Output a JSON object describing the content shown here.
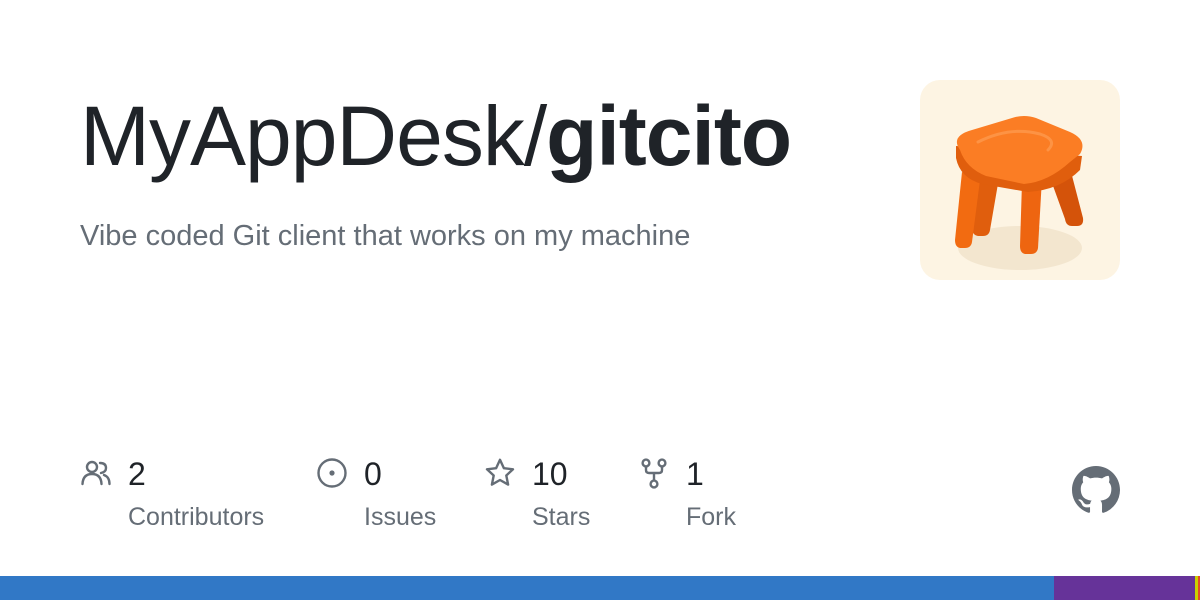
{
  "repo": {
    "owner": "MyAppDesk",
    "separator": "/",
    "name": "gitcito",
    "description": "Vibe coded Git client that works on my machine",
    "avatar_icon": "orange-stool-icon"
  },
  "stats": [
    {
      "key": "contributors",
      "icon": "people-icon",
      "value": "2",
      "label": "Contributors"
    },
    {
      "key": "issues",
      "icon": "issue-opened-icon",
      "value": "0",
      "label": "Issues"
    },
    {
      "key": "stars",
      "icon": "star-icon",
      "value": "10",
      "label": "Stars"
    },
    {
      "key": "forks",
      "icon": "repo-forked-icon",
      "value": "1",
      "label": "Fork"
    }
  ],
  "branding": {
    "logo_icon": "github-mark-icon"
  },
  "language_bar": [
    {
      "color": "#3178c6",
      "share": 0.878
    },
    {
      "color": "#663399",
      "share": 0.118
    },
    {
      "color": "#cbd000",
      "share": 0.002
    },
    {
      "color": "#e34c26",
      "share": 0.002
    }
  ],
  "colors": {
    "text_primary": "#1f2328",
    "text_secondary": "#656d76",
    "icon": "#656d76",
    "avatar_bg": "#fdf4e3",
    "stool_orange": "#f26b11"
  }
}
